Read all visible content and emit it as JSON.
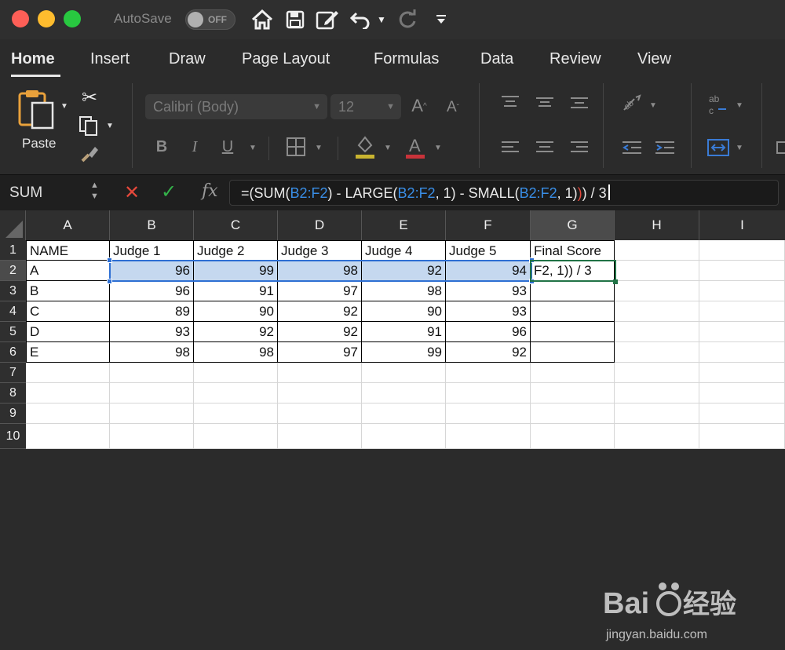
{
  "titlebar": {
    "autosave_label": "AutoSave",
    "autosave_state": "OFF",
    "icons": [
      "home-icon",
      "save-icon",
      "edit-doc-icon",
      "undo-icon",
      "chevron-down-icon",
      "redo-icon",
      "customize-toolbar-icon"
    ]
  },
  "tabs": [
    {
      "label": "Home",
      "active": true
    },
    {
      "label": "Insert"
    },
    {
      "label": "Draw"
    },
    {
      "label": "Page Layout"
    },
    {
      "label": "Formulas"
    },
    {
      "label": "Data"
    },
    {
      "label": "Review"
    },
    {
      "label": "View"
    }
  ],
  "ribbon": {
    "paste_label": "Paste",
    "font_name": "Calibri (Body)",
    "font_size": "12",
    "bold": "B",
    "italic": "I",
    "underline": "U"
  },
  "formula_bar": {
    "name_box": "SUM",
    "fx": "fx",
    "cancel": "✕",
    "enter": "✓",
    "formula_parts": {
      "p1": "=(SUM(",
      "r1": "B2:F2",
      "p2": ") - LARGE(",
      "r2": "B2:F2",
      "p3": ", 1) - SMALL(",
      "r3": "B2:F2",
      "p4": ", 1)",
      "p5": ") / 3"
    }
  },
  "sheet": {
    "columns": [
      "A",
      "B",
      "C",
      "D",
      "E",
      "F",
      "G",
      "H",
      "I"
    ],
    "rows": [
      "1",
      "2",
      "3",
      "4",
      "5",
      "6",
      "7",
      "8",
      "9",
      "10"
    ],
    "header_row": [
      "NAME",
      "Judge 1",
      "Judge 2",
      "Judge 3",
      "Judge 4",
      "Judge 5",
      "Final Score"
    ],
    "data": [
      {
        "name": "A",
        "scores": [
          "96",
          "99",
          "98",
          "92",
          "94"
        ],
        "final": "F2, 1)) / 3"
      },
      {
        "name": "B",
        "scores": [
          "96",
          "91",
          "97",
          "98",
          "93"
        ],
        "final": ""
      },
      {
        "name": "C",
        "scores": [
          "89",
          "90",
          "92",
          "90",
          "93"
        ],
        "final": ""
      },
      {
        "name": "D",
        "scores": [
          "93",
          "92",
          "92",
          "91",
          "96"
        ],
        "final": ""
      },
      {
        "name": "E",
        "scores": [
          "98",
          "98",
          "97",
          "99",
          "92"
        ],
        "final": ""
      }
    ],
    "active_cell": "G2",
    "referenced_range": "B2:F2"
  },
  "colors": {
    "reference_blue": "#3a8ee6",
    "selection_green": "#217346",
    "range_fill": "#c5d8ef"
  }
}
